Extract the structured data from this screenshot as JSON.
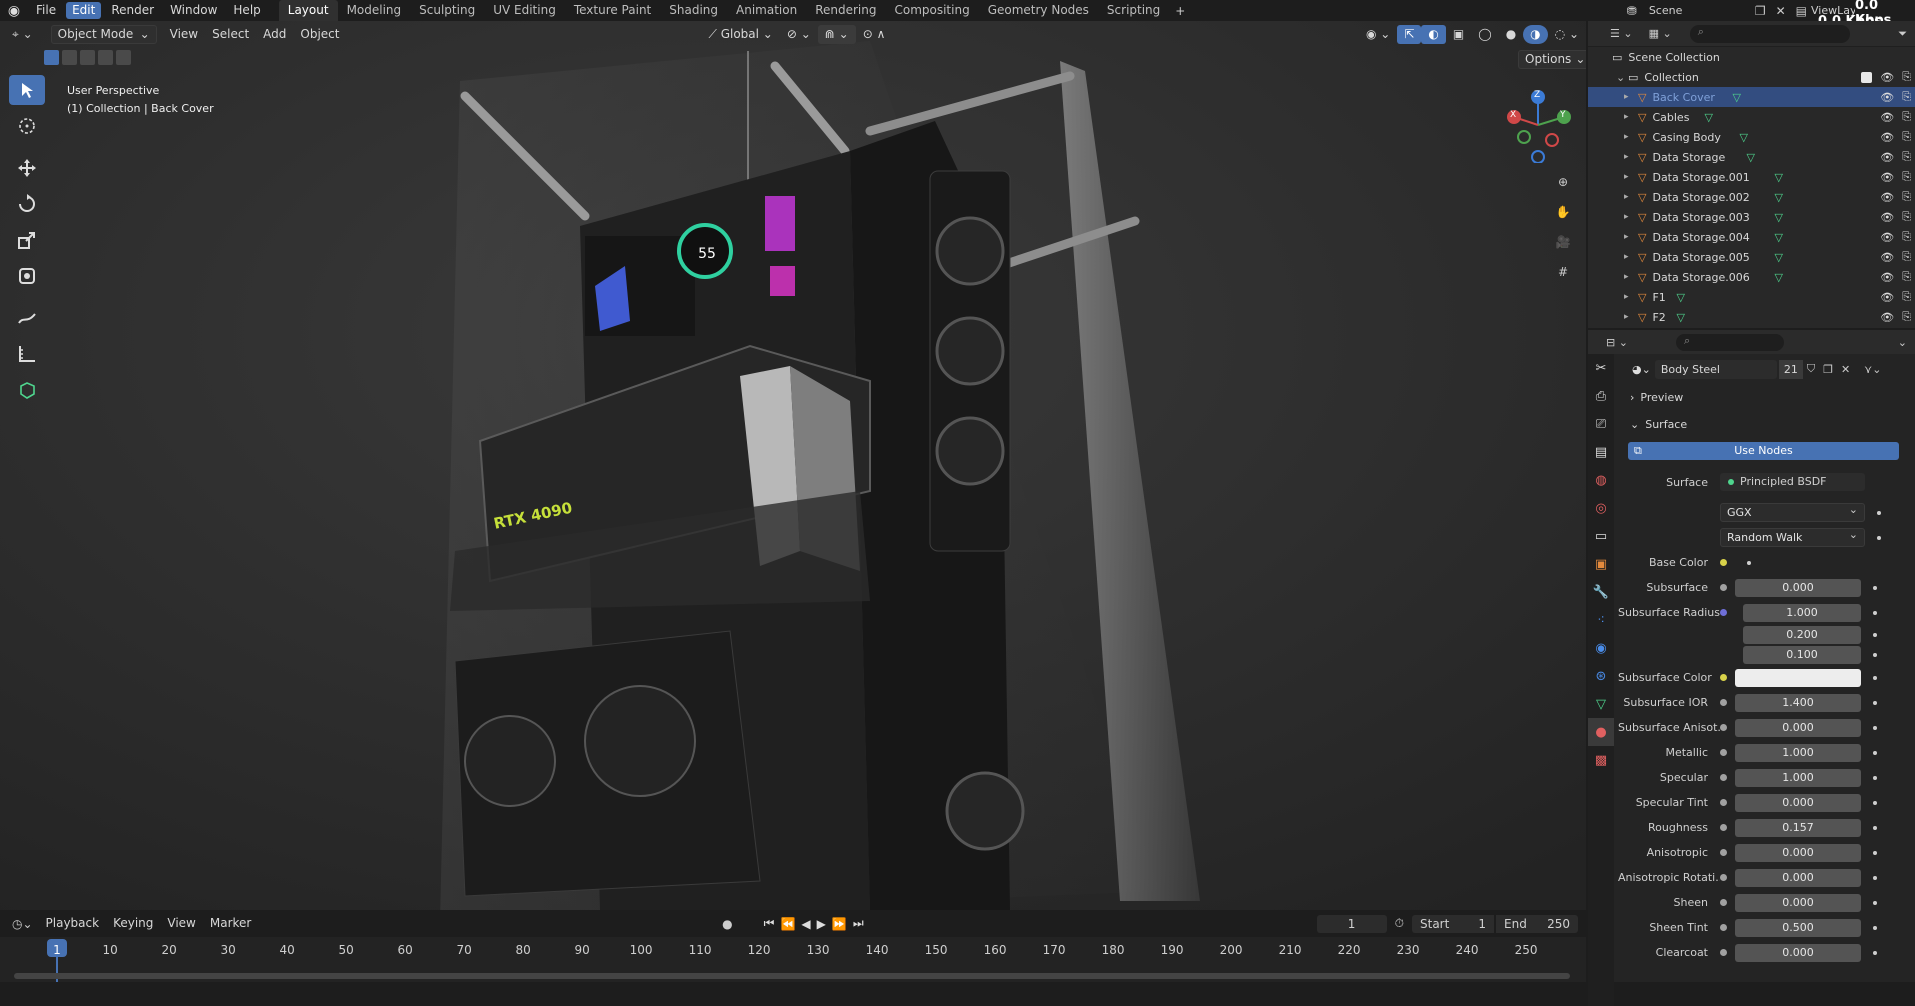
{
  "topbar": {
    "menus": [
      "File",
      "Edit",
      "Render",
      "Window",
      "Help"
    ],
    "active_menu": "Edit",
    "workspaces": [
      "Layout",
      "Modeling",
      "Sculpting",
      "UV Editing",
      "Texture Paint",
      "Shading",
      "Animation",
      "Rendering",
      "Compositing",
      "Geometry Nodes",
      "Scripting"
    ],
    "active_workspace": "Layout",
    "scene": "Scene",
    "view_layer": "ViewLaye",
    "net_up": "0.0 Kbps",
    "net_down": "0.0 Kbps"
  },
  "viewport": {
    "mode": "Object Mode",
    "menus": [
      "View",
      "Select",
      "Add",
      "Object"
    ],
    "orientation": "Global",
    "options": "Options",
    "overlay_line1": "User Perspective",
    "overlay_line2": "(1) Collection | Back Cover",
    "gpu_label": "RTX 4090",
    "cooler_display": "55",
    "gizmo": {
      "x": "X",
      "y": "Y",
      "z": "Z"
    }
  },
  "outliner": {
    "root": "Scene Collection",
    "collection": "Collection",
    "items": [
      {
        "name": "Back Cover",
        "selected": true
      },
      {
        "name": "Cables",
        "selected": false
      },
      {
        "name": "Casing Body",
        "selected": false
      },
      {
        "name": "Data Storage",
        "selected": false
      },
      {
        "name": "Data Storage.001",
        "selected": false
      },
      {
        "name": "Data Storage.002",
        "selected": false
      },
      {
        "name": "Data Storage.003",
        "selected": false
      },
      {
        "name": "Data Storage.004",
        "selected": false
      },
      {
        "name": "Data Storage.005",
        "selected": false
      },
      {
        "name": "Data Storage.006",
        "selected": false
      },
      {
        "name": "F1",
        "selected": false
      },
      {
        "name": "F2",
        "selected": false
      }
    ]
  },
  "properties": {
    "material_name": "Body Steel",
    "users": "21",
    "preview_label": "Preview",
    "surface_panel": "Surface",
    "use_nodes": "Use Nodes",
    "surface_label": "Surface",
    "surface_shader": "Principled BSDF",
    "distribution": "GGX",
    "subsurface_method": "Random Walk",
    "rows": [
      {
        "label": "Base Color",
        "value": "",
        "fill": 0
      },
      {
        "label": "Subsurface",
        "value": "0.000",
        "fill": 0
      },
      {
        "label": "Subsurface Radius",
        "value": "1.000",
        "fill": 0
      },
      {
        "label": "",
        "value": "0.200",
        "fill": 0
      },
      {
        "label": "",
        "value": "0.100",
        "fill": 0
      },
      {
        "label": "Subsurface Color",
        "value": "",
        "fill": 0
      },
      {
        "label": "Subsurface IOR",
        "value": "1.400",
        "fill": 0.1
      },
      {
        "label": "Subsurface Anisot...",
        "value": "0.000",
        "fill": 0
      },
      {
        "label": "Metallic",
        "value": "1.000",
        "fill": 1
      },
      {
        "label": "Specular",
        "value": "1.000",
        "fill": 1
      },
      {
        "label": "Specular Tint",
        "value": "0.000",
        "fill": 0
      },
      {
        "label": "Roughness",
        "value": "0.157",
        "fill": 0.157
      },
      {
        "label": "Anisotropic",
        "value": "0.000",
        "fill": 0
      },
      {
        "label": "Anisotropic Rotati...",
        "value": "0.000",
        "fill": 0
      },
      {
        "label": "Sheen",
        "value": "0.000",
        "fill": 0
      },
      {
        "label": "Sheen Tint",
        "value": "0.500",
        "fill": 0.5
      },
      {
        "label": "Clearcoat",
        "value": "0.000",
        "fill": 0
      }
    ]
  },
  "timeline": {
    "menus": [
      "Playback",
      "Keying",
      "View",
      "Marker"
    ],
    "current_frame": "1",
    "start_label": "Start",
    "start": "1",
    "end_label": "End",
    "end": "250",
    "ticks": [
      "1",
      "10",
      "20",
      "30",
      "40",
      "50",
      "60",
      "70",
      "80",
      "90",
      "100",
      "110",
      "120",
      "130",
      "140",
      "150",
      "160",
      "170",
      "180",
      "190",
      "200",
      "210",
      "220",
      "230",
      "240",
      "250"
    ]
  },
  "colors": {
    "accent": "#4772b3",
    "gpu_text": "#c6e03a",
    "object_icon": "#e38a3d",
    "mesh_icon": "#4fd58e"
  }
}
